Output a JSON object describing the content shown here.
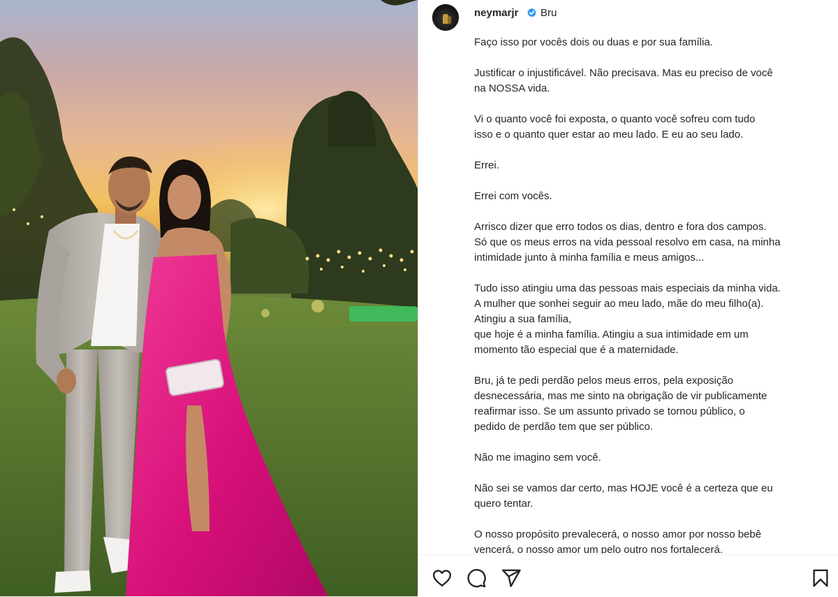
{
  "post": {
    "username": "neymarjr",
    "verified": true,
    "header_text": "Bru",
    "avatar": "avatar",
    "photo": "couple-photo",
    "caption_paragraphs": [
      "Faço isso por vocês dois ou duas e por sua família.",
      "Justificar o injustificável. Não precisava. Mas eu preciso de você\nna NOSSA vida.",
      "Vi o quanto você foi exposta, o quanto você sofreu com tudo\nisso e o quanto quer estar ao meu lado. E eu ao seu lado.",
      "Errei.",
      "Errei com vocês.",
      "Arrisco dizer que erro todos os dias, dentro e fora dos campos.\nSó que os meus erros na vida pessoal resolvo em casa, na minha\nintimidade junto à minha família e meus amigos...",
      "Tudo isso atingiu uma das pessoas mais especiais da minha vida.\nA mulher que sonhei seguir ao meu lado, mãe do meu filho(a).\nAtingiu a sua família,\nque hoje é a minha família. Atingiu a sua intimidade em um\nmomento tão especial que é a maternidade.",
      "Bru, já te pedi perdão pelos meus erros, pela exposição\ndesnecessária, mas me sinto na obrigação de vir publicamente\nreafirmar isso. Se um assunto privado se tornou público, o\npedido de perdão tem que ser público.",
      "Não me imagino sem você.",
      "Não sei se vamos dar certo, mas HOJE você é a certeza que eu\nquero tentar.",
      "O nosso propósito prevalecerá, o nosso amor por nosso bebê\nvencerá, o nosso amor um pelo outro nos fortalecerá."
    ]
  },
  "actions": {
    "like": "heart-icon",
    "comment": "comment-icon",
    "share": "share-icon",
    "save": "bookmark-icon"
  },
  "colors": {
    "verified": "#3897f0",
    "dress": "#e0157e",
    "text": "#262626"
  }
}
